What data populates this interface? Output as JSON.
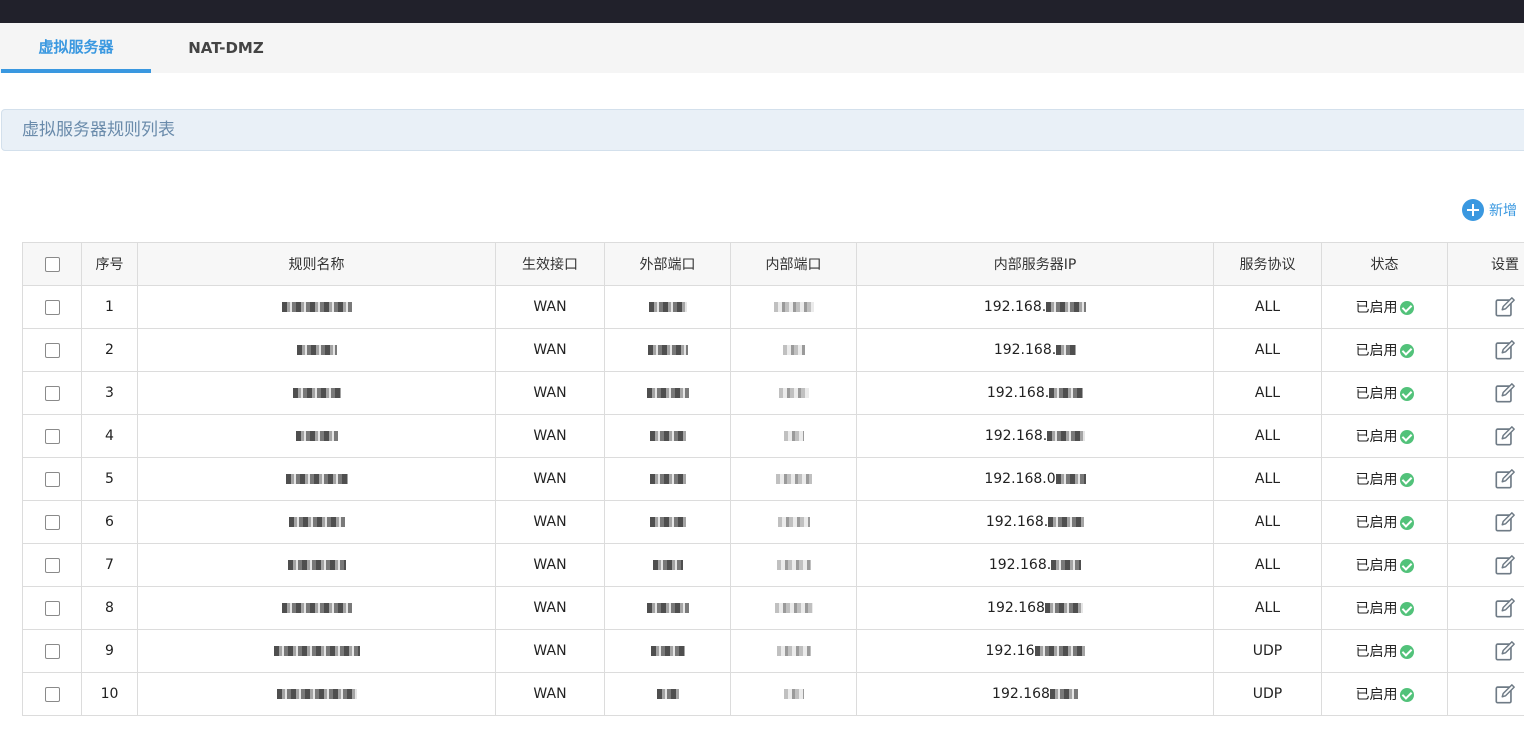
{
  "tabs": [
    {
      "label": "虚拟服务器",
      "active": true
    },
    {
      "label": "NAT-DMZ",
      "active": false
    }
  ],
  "section": {
    "title": "虚拟服务器规则列表"
  },
  "toolbar": {
    "add_label": "新增",
    "add_icon": "plus-circle-icon"
  },
  "table": {
    "headers": [
      "",
      "序号",
      "规则名称",
      "生效接口",
      "外部端口",
      "内部端口",
      "内部服务器IP",
      "服务协议",
      "状态",
      "设置"
    ],
    "rows": [
      {
        "index": "1",
        "name": "",
        "interface": "WAN",
        "ext_port": "",
        "int_port": "",
        "ip": "192.168.",
        "protocol": "ALL",
        "status": "已启用"
      },
      {
        "index": "2",
        "name": "",
        "interface": "WAN",
        "ext_port": "",
        "int_port": "",
        "ip": "192.168.",
        "protocol": "ALL",
        "status": "已启用"
      },
      {
        "index": "3",
        "name": "",
        "interface": "WAN",
        "ext_port": "",
        "int_port": "",
        "ip": "192.168.",
        "protocol": "ALL",
        "status": "已启用"
      },
      {
        "index": "4",
        "name": "",
        "interface": "WAN",
        "ext_port": "",
        "int_port": "",
        "ip": "192.168.",
        "protocol": "ALL",
        "status": "已启用"
      },
      {
        "index": "5",
        "name": "",
        "interface": "WAN",
        "ext_port": "",
        "int_port": "",
        "ip": "192.168.0",
        "protocol": "ALL",
        "status": "已启用"
      },
      {
        "index": "6",
        "name": "",
        "interface": "WAN",
        "ext_port": "",
        "int_port": "",
        "ip": "192.168.",
        "protocol": "ALL",
        "status": "已启用"
      },
      {
        "index": "7",
        "name": "",
        "interface": "WAN",
        "ext_port": "",
        "int_port": "",
        "ip": "192.168.",
        "protocol": "ALL",
        "status": "已启用"
      },
      {
        "index": "8",
        "name": "",
        "interface": "WAN",
        "ext_port": "",
        "int_port": "",
        "ip": "192.168",
        "protocol": "ALL",
        "status": "已启用"
      },
      {
        "index": "9",
        "name": "",
        "interface": "WAN",
        "ext_port": "",
        "int_port": "",
        "ip": "192.16",
        "protocol": "UDP",
        "status": "已启用"
      },
      {
        "index": "10",
        "name": "",
        "interface": "WAN",
        "ext_port": "",
        "int_port": "",
        "ip": "192.168",
        "protocol": "UDP",
        "status": "已启用"
      }
    ]
  },
  "colors": {
    "accent": "#3a98e0",
    "enabled": "#52c27a",
    "topbar": "#21212b"
  }
}
